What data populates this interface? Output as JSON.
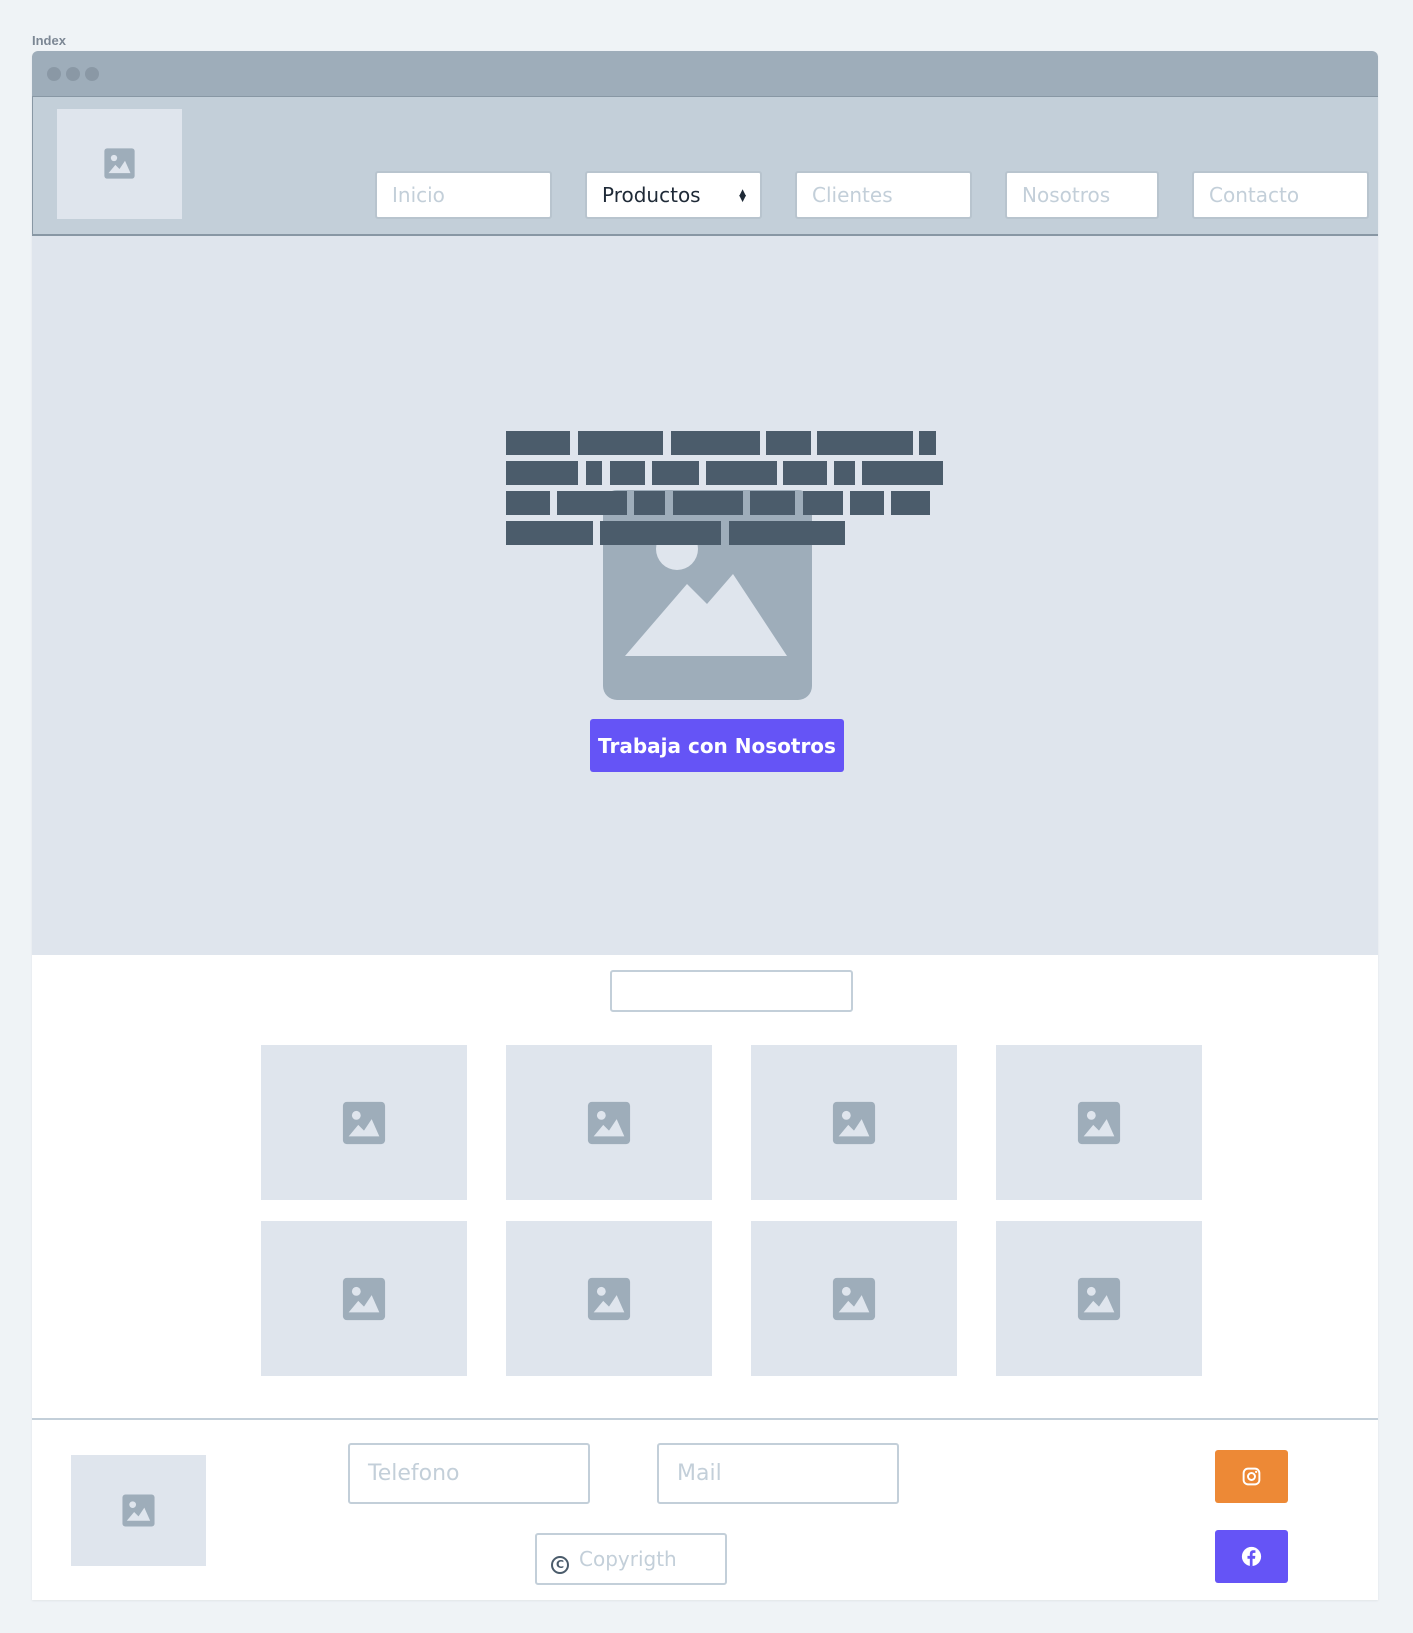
{
  "frame": {
    "label": "Index"
  },
  "nav": {
    "items": [
      {
        "label": "Inicio",
        "type": "link"
      },
      {
        "label": "Productos",
        "type": "select"
      },
      {
        "label": "Clientes",
        "type": "link"
      },
      {
        "label": "Nosotros",
        "type": "link"
      },
      {
        "label": "Contacto",
        "type": "link"
      }
    ]
  },
  "hero": {
    "cta_label": "Trabaja con Nosotros"
  },
  "gallery": {
    "tile_icons": [
      "image-icon",
      "image-icon",
      "image-icon",
      "image-icon",
      "image-icon",
      "image-icon",
      "image-icon",
      "image-icon"
    ]
  },
  "footer": {
    "phone_placeholder": "Telefono",
    "mail_placeholder": "Mail",
    "copyright_label": "Copyrigth",
    "copyright_icon": "copyright-icon",
    "social": [
      {
        "name": "instagram-icon",
        "color": "#ed8936"
      },
      {
        "name": "facebook-icon",
        "color": "#6554f6"
      }
    ]
  },
  "colors": {
    "accent": "#6554f6",
    "instagram": "#ed8936",
    "placeholder_bg": "#dfe5ed",
    "header_bg": "#c3cfd9",
    "titlebar_bg": "#9eadba",
    "text_dark": "#4b5c6b"
  }
}
